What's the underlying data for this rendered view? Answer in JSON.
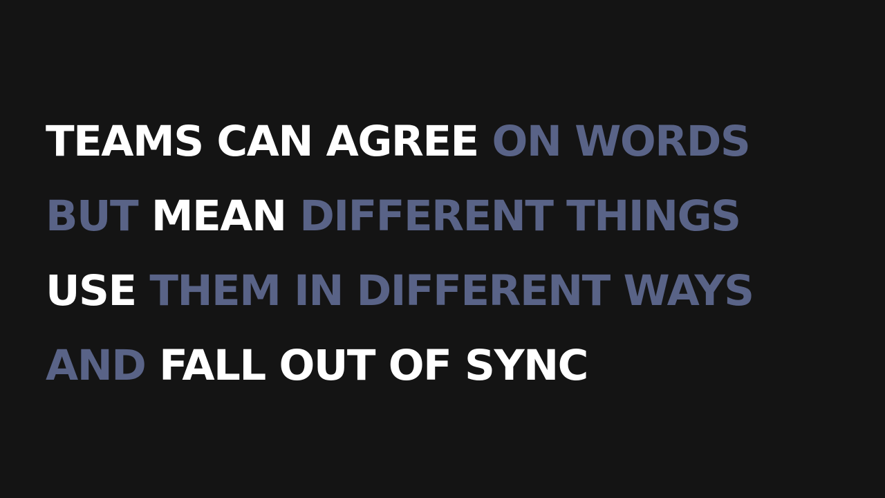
{
  "colors": {
    "background": "#141414",
    "highlight": "#ffffff",
    "muted": "#596387"
  },
  "lines": [
    {
      "seg1": "TEAMS CAN AGREE",
      "seg2": "ON WORDS"
    },
    {
      "seg1": "BUT",
      "seg2": "MEAN",
      "seg3": "DIFFERENT THINGS"
    },
    {
      "seg1": "USE",
      "seg2": "THEM IN DIFFERENT WAYS"
    },
    {
      "seg1": "AND",
      "seg2": "FALL OUT OF SYNC"
    }
  ]
}
